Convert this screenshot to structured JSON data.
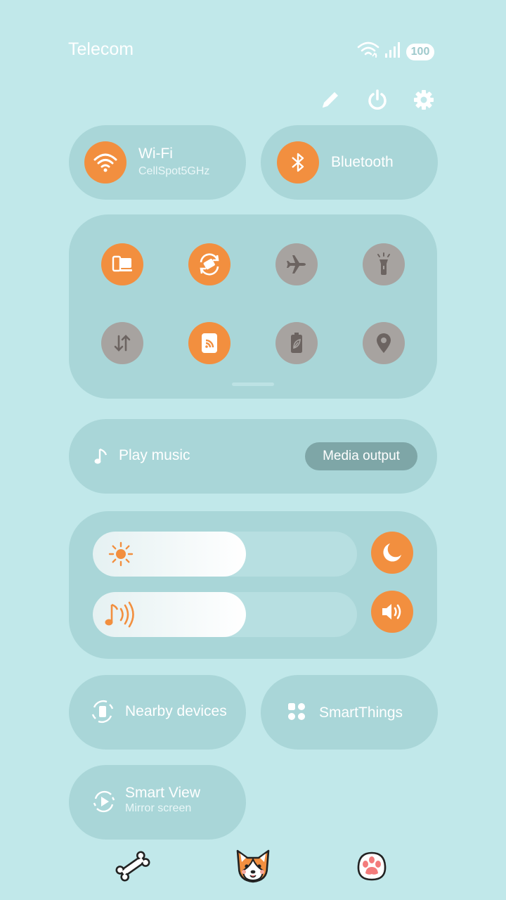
{
  "status_bar": {
    "carrier": "Telecom",
    "battery": "100",
    "icons": [
      "wifi-icon",
      "signal-icon",
      "battery-icon"
    ]
  },
  "top_actions": [
    "edit-icon",
    "power-icon",
    "settings-icon"
  ],
  "connectivity": {
    "wifi": {
      "label": "Wi-Fi",
      "network": "CellSpot5GHz",
      "enabled": true
    },
    "bluetooth": {
      "label": "Bluetooth",
      "enabled": true
    }
  },
  "quick_toggles": [
    {
      "icon": "device-switch-icon",
      "enabled": true
    },
    {
      "icon": "auto-rotate-icon",
      "enabled": true
    },
    {
      "icon": "airplane-icon",
      "enabled": false
    },
    {
      "icon": "flashlight-icon",
      "enabled": false
    },
    {
      "icon": "mobile-data-icon",
      "enabled": false
    },
    {
      "icon": "cast-icon",
      "enabled": true
    },
    {
      "icon": "power-saving-icon",
      "enabled": false
    },
    {
      "icon": "location-icon",
      "enabled": false
    }
  ],
  "media": {
    "play_label": "Play music",
    "output_label": "Media output"
  },
  "sliders": {
    "brightness": {
      "level_percent": 58
    },
    "volume": {
      "level_percent": 58
    }
  },
  "device_tiles": {
    "nearby": {
      "label": "Nearby devices"
    },
    "smartthings": {
      "label": "SmartThings"
    },
    "smart_view": {
      "label": "Smart View",
      "sub": "Mirror screen"
    }
  },
  "theme_icons": [
    "bone-icon",
    "corgi-face-icon",
    "paw-icon"
  ],
  "colors": {
    "accent": "#f28f3f",
    "background": "#c1e8ea",
    "tile": "#a9d6d8",
    "inactive": "#a7a3a0"
  }
}
